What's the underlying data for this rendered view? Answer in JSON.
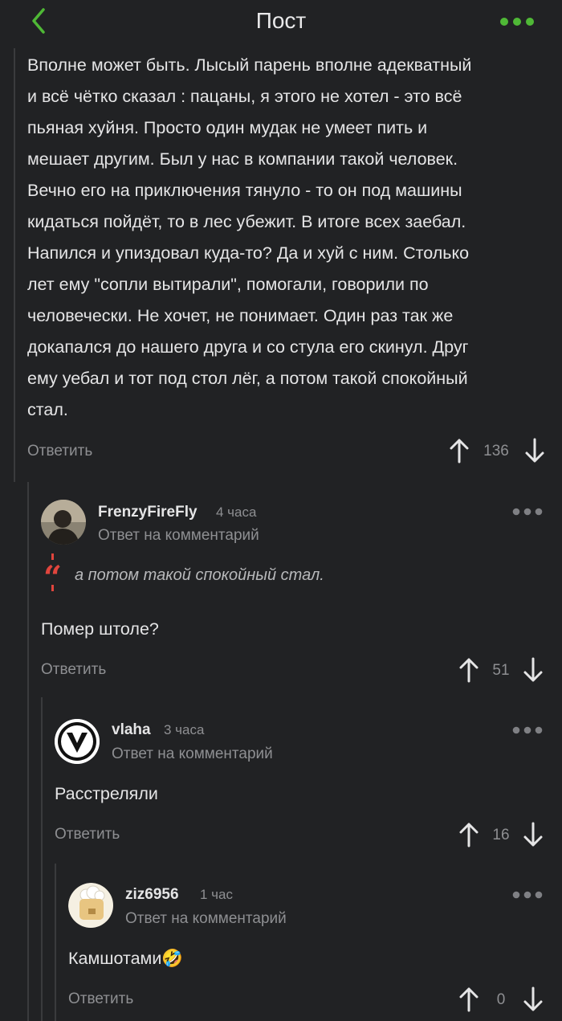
{
  "header": {
    "title": "Пост"
  },
  "post": {
    "text": "Вполне может быть. Лысый парень вполне адекватный\nи всё чётко сказал : пацаны, я этого не хотел - это всё\nпьяная хуйня. Просто один мудак не умеет пить и\nмешает другим. Был у нас в компании такой человек.\nВечно его на приключения тянуло - то он под машины\nкидаться пойдёт, то в лес убежит. В итоге всех заебал.\nНапился и упиздовал куда-то? Да и хуй с ним. Столько\nлет ему \"сопли вытирали\", помогали, говорили по\nчеловечески. Не хочет, не понимает. Один раз так же\nдокапался до нашего друга и со стула его скинул. Друг\nему уебал и тот под стол лёг, а потом такой спокойный\nстал.",
    "reply_label": "Ответить",
    "rating": "136"
  },
  "comments": [
    {
      "username": "FrenzyFireFly",
      "time": "4 часа",
      "reply_to": "Ответ на комментарий",
      "quote": "а потом такой спокойный стал.",
      "text": "Помер штоле?",
      "reply_label": "Ответить",
      "rating": "51"
    },
    {
      "username": "vlaha",
      "time": "3 часа",
      "reply_to": "Ответ на комментарий",
      "text": "Расстреляли",
      "reply_label": "Ответить",
      "rating": "16"
    },
    {
      "username": "ziz6956",
      "time": "1 час",
      "reply_to": "Ответ на комментарий",
      "text": "Камшотами🤣",
      "reply_label": "Ответить",
      "rating": "0"
    }
  ],
  "colors": {
    "background": "#212224",
    "accent_green": "#4fb836",
    "quote_red": "#e0453d",
    "muted_text": "#8e8f92"
  },
  "icons": [
    "chevron-left-icon",
    "more-dots-icon",
    "arrow-up-icon",
    "arrow-down-icon",
    "quote-icon"
  ]
}
